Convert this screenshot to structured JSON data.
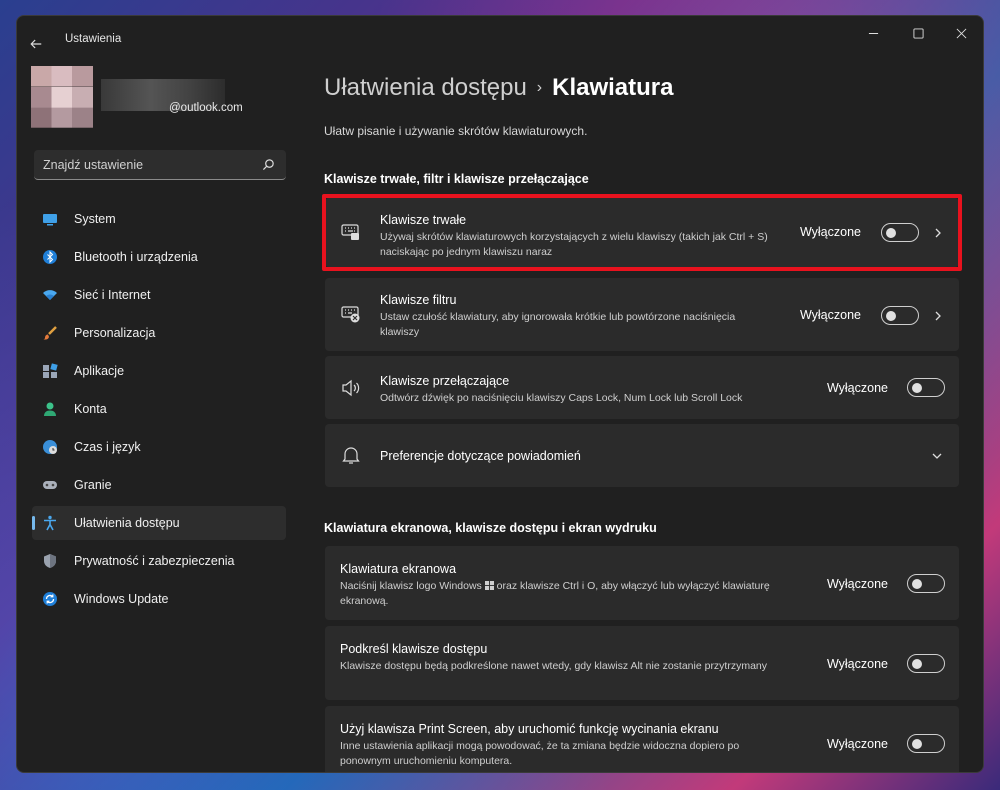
{
  "window": {
    "app_title": "Ustawienia"
  },
  "profile": {
    "email": "@outlook.com"
  },
  "search": {
    "placeholder": "Znajdź ustawienie"
  },
  "sidebar": {
    "items": [
      {
        "label": "System",
        "icon": "system-icon"
      },
      {
        "label": "Bluetooth i urządzenia",
        "icon": "bluetooth-icon"
      },
      {
        "label": "Sieć i Internet",
        "icon": "wifi-icon"
      },
      {
        "label": "Personalizacja",
        "icon": "brush-icon"
      },
      {
        "label": "Aplikacje",
        "icon": "apps-icon"
      },
      {
        "label": "Konta",
        "icon": "account-icon"
      },
      {
        "label": "Czas i język",
        "icon": "globe-icon"
      },
      {
        "label": "Granie",
        "icon": "gamepad-icon"
      },
      {
        "label": "Ułatwienia dostępu",
        "icon": "accessibility-icon",
        "active": true
      },
      {
        "label": "Prywatność i zabezpieczenia",
        "icon": "shield-icon"
      },
      {
        "label": "Windows Update",
        "icon": "update-icon"
      }
    ]
  },
  "breadcrumb": {
    "parent": "Ułatwienia dostępu",
    "separator": "›",
    "current": "Klawiatura"
  },
  "page_description": "Ułatw pisanie i używanie skrótów klawiaturowych.",
  "sections": [
    {
      "title": "Klawisze trwałe, filtr i klawisze przełączające",
      "cards": [
        {
          "title": "Klawisze trwałe",
          "description": "Używaj skrótów klawiaturowych korzystających z wielu klawiszy (takich jak Ctrl + S) naciskając po jednym klawiszu naraz",
          "status": "Wyłączone",
          "toggle_on": false,
          "icon": "sticky-keys-icon"
        },
        {
          "title": "Klawisze filtru",
          "description": "Ustaw czułość klawiatury, aby ignorowała krótkie lub powtórzone naciśnięcia klawiszy",
          "status": "Wyłączone",
          "toggle_on": false,
          "icon": "filter-keys-icon"
        },
        {
          "title": "Klawisze przełączające",
          "description": "Odtwórz dźwięk po naciśnięciu klawiszy Caps Lock, Num Lock lub Scroll Lock",
          "status": "Wyłączone",
          "toggle_on": false,
          "icon": "speaker-icon"
        },
        {
          "title": "Preferencje dotyczące powiadomień",
          "icon": "bell-icon"
        }
      ]
    },
    {
      "title": "Klawiatura ekranowa, klawisze dostępu i ekran wydruku",
      "cards": [
        {
          "title": "Klawiatura ekranowa",
          "description_before": "Naciśnij klawisz logo Windows",
          "description_after": "oraz klawisze Ctrl i O, aby włączyć lub wyłączyć klawiaturę ekranową.",
          "status": "Wyłączone",
          "toggle_on": false
        },
        {
          "title": "Podkreśl klawisze dostępu",
          "description": "Klawisze dostępu będą podkreślone nawet wtedy, gdy klawisz Alt nie zostanie przytrzymany",
          "status": "Wyłączone",
          "toggle_on": false
        },
        {
          "title": "Użyj klawisza Print Screen, aby uruchomić funkcję wycinania ekranu",
          "description": "Inne ustawienia aplikacji mogą powodować, że ta zmiana będzie widoczna dopiero po ponownym uruchomieniu komputera.",
          "status": "Wyłączone",
          "toggle_on": false
        }
      ]
    }
  ],
  "colors": {
    "window_bg": "#202020",
    "card_bg": "#2b2b2b",
    "accent": "#76b9ed",
    "highlight_border": "#e8121e"
  }
}
